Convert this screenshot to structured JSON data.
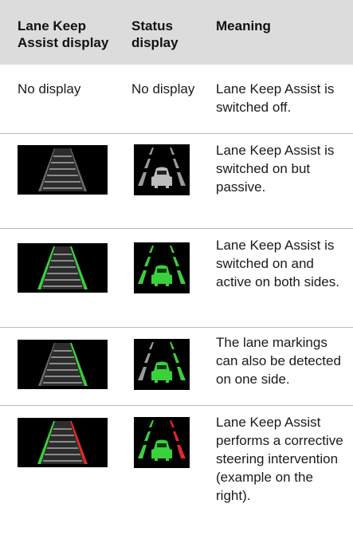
{
  "header": {
    "col1": "Lane Keep Assist display",
    "col2": "Status display",
    "col3": "Meaning"
  },
  "rows": [
    {
      "col1_text": "No display",
      "col2_text": "No display",
      "meaning": "Lane Keep Assist is switched off.",
      "icon1": "none",
      "icon2": "none"
    },
    {
      "meaning": "Lane Keep Assist is switched on but passive.",
      "icon1": "lane-road-grey-icon",
      "icon2": "car-lanes-grey-icon"
    },
    {
      "meaning": "Lane Keep Assist is switched on and active on both sides.",
      "icon1": "lane-road-green-both-icon",
      "icon2": "car-lanes-green-both-icon"
    },
    {
      "meaning": "The lane markings can also be detected on one side.",
      "icon1": "lane-road-green-right-icon",
      "icon2": "car-lanes-green-right-icon"
    },
    {
      "meaning": "Lane Keep Assist performs a corrective steering intervention (example on the right).",
      "icon1": "lane-road-green-red-icon",
      "icon2": "car-lanes-green-red-icon"
    }
  ],
  "colors": {
    "header_bg": "#dcdcdc",
    "active_green": "#3ad13a",
    "warning_red": "#e0282a",
    "passive_grey": "#9a9a9a"
  }
}
